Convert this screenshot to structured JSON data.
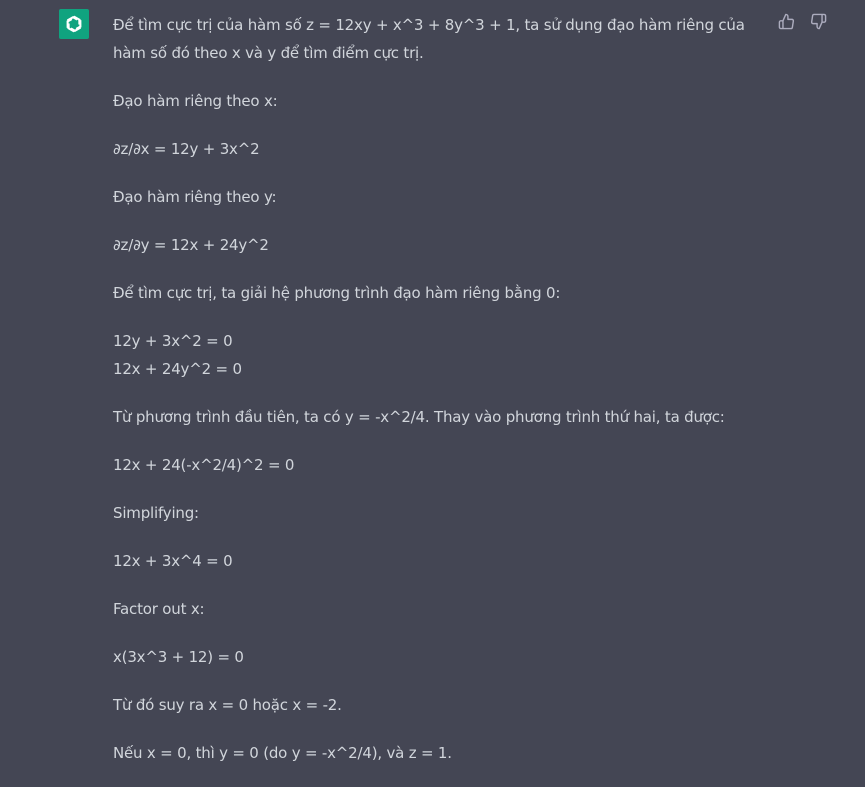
{
  "message": {
    "author_icon": "openai-logo-icon",
    "feedback": {
      "thumbs_up_icon": "thumbs-up-icon",
      "thumbs_down_icon": "thumbs-down-icon"
    },
    "paragraphs": [
      "Để tìm cực trị của hàm số z = 12xy + x^3 + 8y^3 + 1, ta sử dụng đạo hàm riêng của hàm số đó theo x và y để tìm điểm cực trị.",
      "Đạo hàm riêng theo x:",
      "∂z/∂x = 12y + 3x^2",
      "Đạo hàm riêng theo y:",
      "∂z/∂y = 12x + 24y^2",
      "Để tìm cực trị, ta giải hệ phương trình đạo hàm riêng bằng 0:",
      "12y + 3x^2 = 0",
      "12x + 24y^2 = 0",
      "Từ phương trình đầu tiên, ta có y = -x^2/4. Thay vào phương trình thứ hai, ta được:",
      "12x + 24(-x^2/4)^2 = 0",
      "Simplifying:",
      "12x + 3x^4 = 0",
      "Factor out x:",
      "x(3x^3 + 12) = 0",
      "Từ đó suy ra x = 0 hoặc x = -2.",
      "Nếu x = 0, thì y = 0 (do y = -x^2/4), và z = 1."
    ]
  },
  "colors": {
    "background": "#444654",
    "text": "#d1d5db",
    "avatar_bg": "#10a37f",
    "icon": "#acacbe"
  }
}
